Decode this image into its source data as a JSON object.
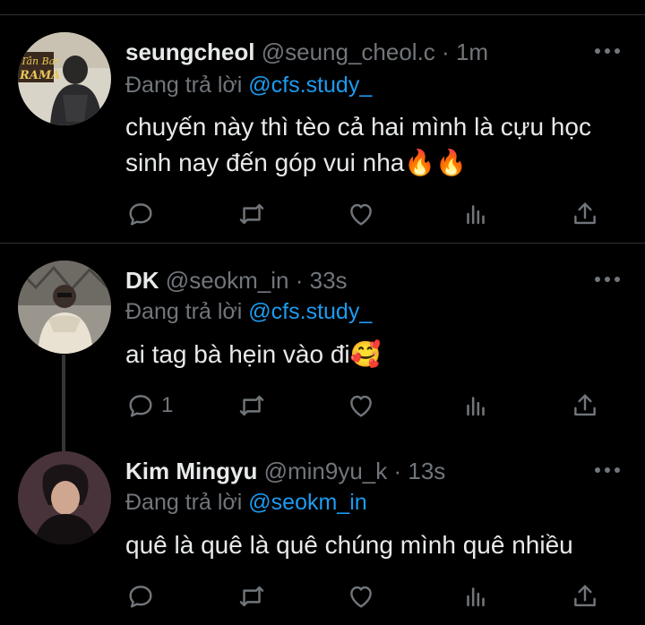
{
  "colors": {
    "background": "#000000",
    "text": "#e7e9ea",
    "muted": "#71767b",
    "link": "#1d9bf0",
    "divider": "#2f3336"
  },
  "tweets": [
    {
      "name": "seungcheol",
      "handle": "@seung_cheol.c",
      "sep": "·",
      "time": "1m",
      "reply_prefix": "Đang trả lời",
      "reply_to": "@cfs.study_",
      "text": "chuyến này thì tèo cả hai mình là cựu học sinh nay đến góp vui nha🔥🔥",
      "actions": {
        "reply_icon": "comment-icon",
        "retweet_icon": "retweet-icon",
        "like_icon": "heart-icon",
        "views_icon": "bar-chart-icon",
        "share_icon": "share-icon",
        "reply_count": ""
      }
    },
    {
      "name": "DK",
      "handle": "@seokm_in",
      "sep": "·",
      "time": "33s",
      "reply_prefix": "Đang trả lời",
      "reply_to": "@cfs.study_",
      "text": "ai tag bà hẹin vào đi🥰",
      "actions": {
        "reply_icon": "comment-icon",
        "retweet_icon": "retweet-icon",
        "like_icon": "heart-icon",
        "views_icon": "bar-chart-icon",
        "share_icon": "share-icon",
        "reply_count": "1"
      }
    },
    {
      "name": "Kim Mingyu",
      "handle": "@min9yu_k",
      "sep": "·",
      "time": "13s",
      "reply_prefix": "Đang trả lời",
      "reply_to": "@seokm_in",
      "text": "quê là quê là quê chúng mình quê nhiều",
      "actions": {
        "reply_icon": "comment-icon",
        "retweet_icon": "retweet-icon",
        "like_icon": "heart-icon",
        "views_icon": "bar-chart-icon",
        "share_icon": "share-icon",
        "reply_count": ""
      }
    }
  ],
  "avatar_signs": {
    "tweet0": "Tân Bar RAMA"
  }
}
